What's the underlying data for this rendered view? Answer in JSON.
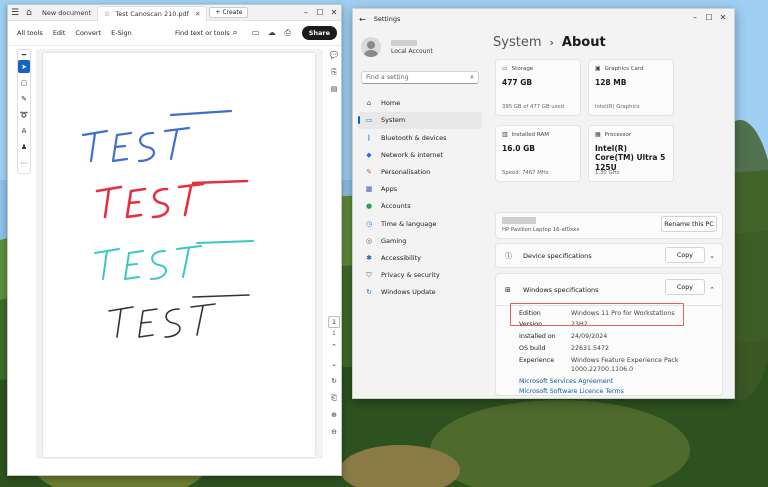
{
  "pdf": {
    "tab_home": "New document",
    "tab_doc": "Test Canoscan 210.pdf",
    "create_label": "Create",
    "menu": [
      "All tools",
      "Edit",
      "Convert",
      "E-Sign"
    ],
    "find_label": "Find text or tools",
    "share_label": "Share",
    "page_number": "1",
    "page_total": "1",
    "handwriting": [
      {
        "text": "TEST",
        "color": "#3f6fcf"
      },
      {
        "text": "TEST",
        "color": "#e53040"
      },
      {
        "text": "TEST",
        "color": "#38c8c0"
      },
      {
        "text": "TEST",
        "color": "#333333"
      }
    ]
  },
  "settings": {
    "window_title": "Settings",
    "account_type": "Local Account",
    "search_placeholder": "Find a setting",
    "breadcrumb_parent": "System",
    "breadcrumb_current": "About",
    "nav": [
      {
        "label": "Home",
        "icon": "home-icon",
        "color": "#555555"
      },
      {
        "label": "System",
        "icon": "monitor-icon",
        "color": "#0067c0"
      },
      {
        "label": "Bluetooth & devices",
        "icon": "bluetooth-icon",
        "color": "#0067c0"
      },
      {
        "label": "Network & internet",
        "icon": "wifi-icon",
        "color": "#1a73e8"
      },
      {
        "label": "Personalisation",
        "icon": "brush-icon",
        "color": "#c7631f"
      },
      {
        "label": "Apps",
        "icon": "apps-icon",
        "color": "#3b5ba8"
      },
      {
        "label": "Accounts",
        "icon": "person-icon",
        "color": "#2aa058"
      },
      {
        "label": "Time & language",
        "icon": "globe-clock-icon",
        "color": "#1a73e8"
      },
      {
        "label": "Gaming",
        "icon": "gamepad-icon",
        "color": "#666666"
      },
      {
        "label": "Accessibility",
        "icon": "accessibility-icon",
        "color": "#1f5fbf"
      },
      {
        "label": "Privacy & security",
        "icon": "shield-icon",
        "color": "#666666"
      },
      {
        "label": "Windows Update",
        "icon": "update-icon",
        "color": "#0a74d6"
      }
    ],
    "cards": {
      "storage": {
        "label": "Storage",
        "value": "477 GB",
        "sub": "395 GB of 477 GB used"
      },
      "graphics": {
        "label": "Graphics Card",
        "value": "128 MB",
        "sub": "Intel(R) Graphics"
      },
      "ram": {
        "label": "Installed RAM",
        "value": "16.0 GB",
        "sub": "Speed: 7467 MHz"
      },
      "processor": {
        "label": "Processor",
        "value": "Intel(R) Core(TM) Ultra 5 125U",
        "sub": "1.30 GHz"
      }
    },
    "device_model": "HP Pavilion Laptop 16-af0xxx",
    "rename_label": "Rename this PC",
    "device_spec_label": "Device specifications",
    "windows_spec_label": "Windows specifications",
    "copy_label": "Copy",
    "specs": [
      {
        "key": "Edition",
        "value": "Windows 11 Pro for Workstations"
      },
      {
        "key": "Version",
        "value": "23H2"
      },
      {
        "key": "Installed on",
        "value": "24/09/2024"
      },
      {
        "key": "OS build",
        "value": "22631.5472"
      },
      {
        "key": "Experience",
        "value": "Windows Feature Experience Pack 1000.22700.1106.0"
      }
    ],
    "links": [
      "Microsoft Services Agreement",
      "Microsoft Software Licence Terms"
    ]
  }
}
